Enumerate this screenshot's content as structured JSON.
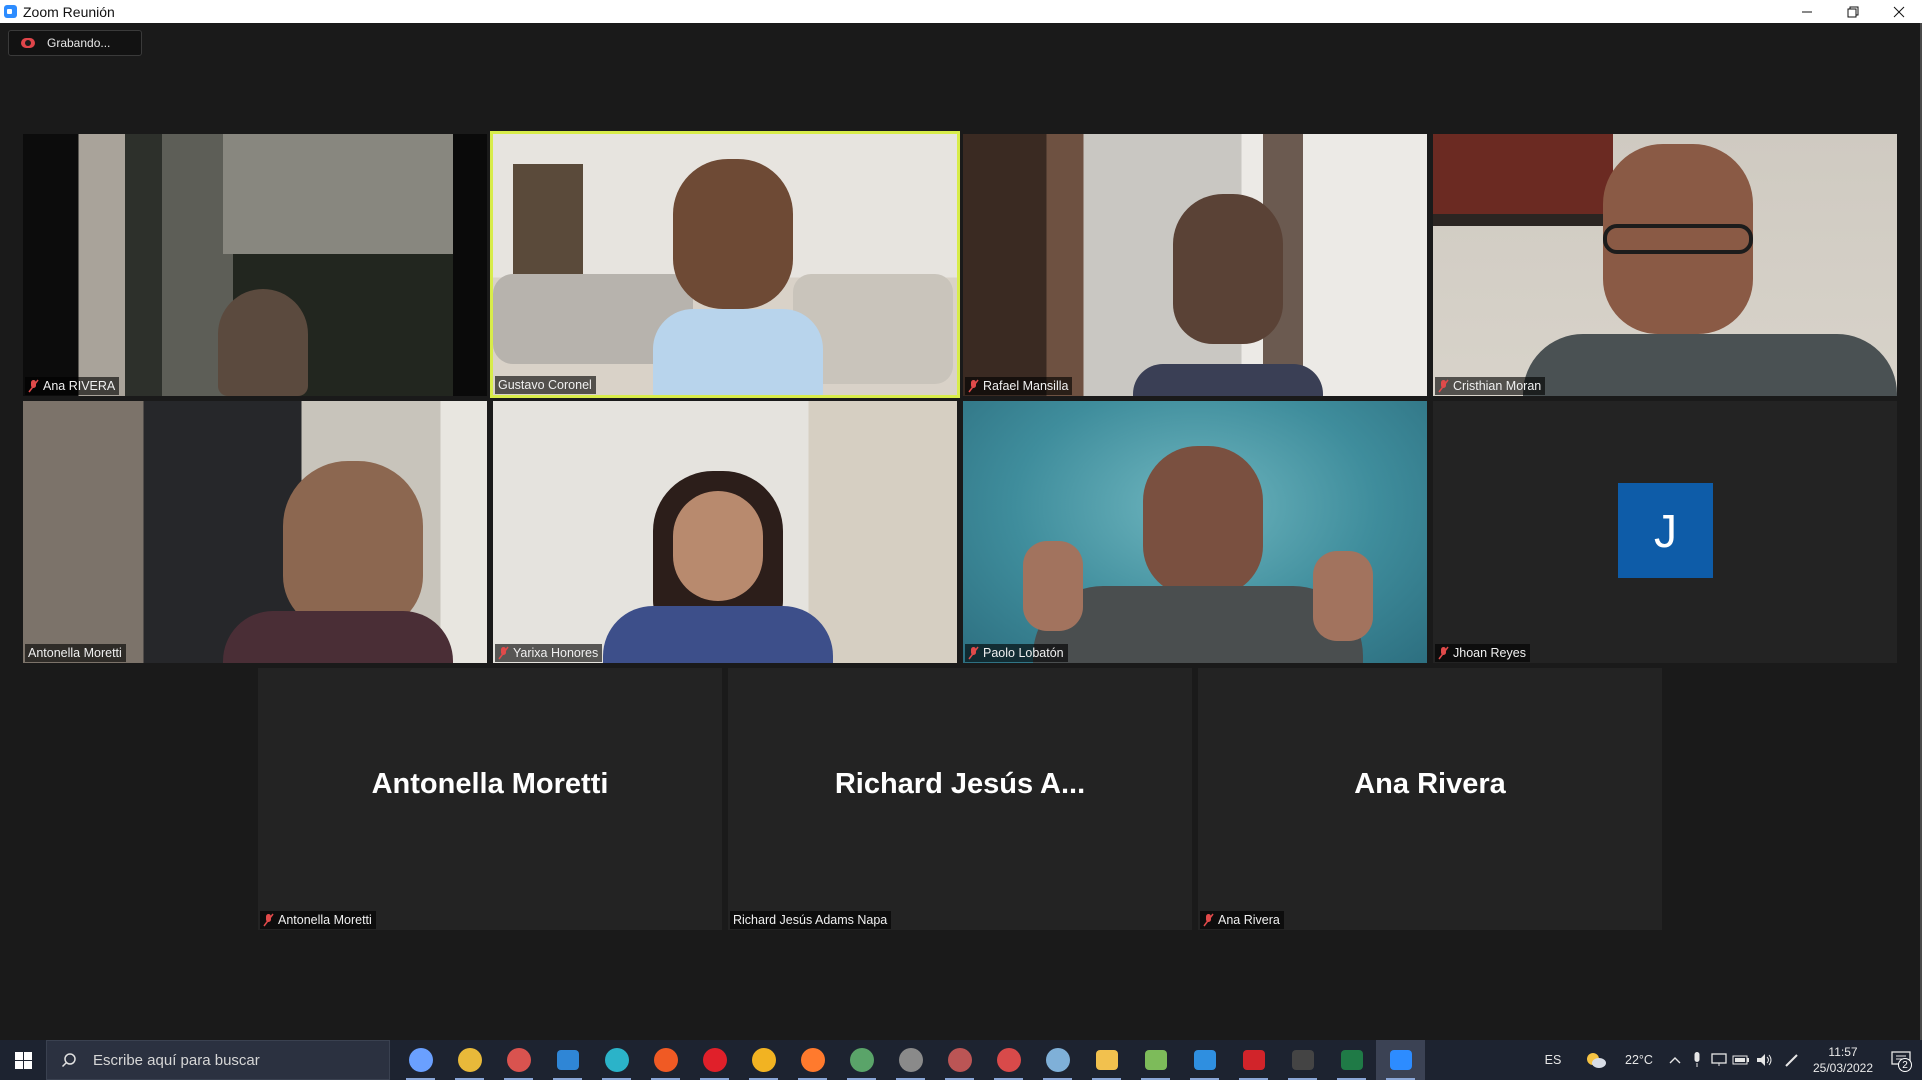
{
  "window": {
    "title": "Zoom Reunión",
    "icon": "zoom-icon",
    "controls": [
      "minimize-icon",
      "restore-icon",
      "close-icon"
    ]
  },
  "recording": {
    "label": "Grabando...",
    "icon": "cloud-record-icon",
    "color": "#e0454a"
  },
  "accent": {
    "active_speaker_border": "#d8ec4a",
    "avatar_bg": "#0e5ca8"
  },
  "participants": [
    {
      "name": "Ana RIVERA",
      "muted": true,
      "video": true
    },
    {
      "name": "Gustavo Coronel",
      "muted": false,
      "video": true,
      "active_speaker": true
    },
    {
      "name": "Rafael Mansilla",
      "muted": true,
      "video": true
    },
    {
      "name": "Cristhian Moran",
      "muted": true,
      "video": true
    },
    {
      "name": "Antonella Moretti",
      "muted": false,
      "video": true
    },
    {
      "name": "Yarixa Honores",
      "muted": true,
      "video": true
    },
    {
      "name": "Paolo Lobatón",
      "muted": true,
      "video": true
    },
    {
      "name": "Jhoan  Reyes",
      "muted": true,
      "video": false,
      "avatar_letter": "J"
    },
    {
      "name": "Antonella Moretti",
      "muted": true,
      "video": false,
      "display_name": "Antonella Moretti"
    },
    {
      "name": "Richard Jesús Adams Napa",
      "muted": false,
      "video": false,
      "display_name": "Richard  Jesús  A..."
    },
    {
      "name": "Ana Rivera",
      "muted": true,
      "video": false,
      "display_name": "Ana Rivera"
    }
  ],
  "taskbar": {
    "search_placeholder": "Escribe aquí para buscar",
    "apps": [
      {
        "icon": "chat-icon",
        "color": "#6aa0ff"
      },
      {
        "icon": "chrome-icon",
        "color": "#e8b93a"
      },
      {
        "icon": "chrome-icon",
        "color": "#d9534f"
      },
      {
        "icon": "mail-icon",
        "color": "#2f86d6"
      },
      {
        "icon": "edge-icon",
        "color": "#2bb3c9"
      },
      {
        "icon": "brave-icon",
        "color": "#f05a24"
      },
      {
        "icon": "opera-icon",
        "color": "#e0202a"
      },
      {
        "icon": "vpn-icon",
        "color": "#f2b322"
      },
      {
        "icon": "firefox-icon",
        "color": "#ff7a2d"
      },
      {
        "icon": "chrome-icon",
        "color": "#5aa469"
      },
      {
        "icon": "chrome-icon",
        "color": "#8a8a8a"
      },
      {
        "icon": "chrome-icon",
        "color": "#b55"
      },
      {
        "icon": "chrome-icon",
        "color": "#d84a4a"
      },
      {
        "icon": "paint-icon",
        "color": "#7fb0d8"
      },
      {
        "icon": "folder-icon",
        "color": "#f2c14e"
      },
      {
        "icon": "notepad-icon",
        "color": "#7dbb5a"
      },
      {
        "icon": "vscode-icon",
        "color": "#2f8fe0"
      },
      {
        "icon": "pdf-icon",
        "color": "#d1242a"
      },
      {
        "icon": "terminal-icon",
        "color": "#444"
      },
      {
        "icon": "excel-icon",
        "color": "#1f7a46"
      },
      {
        "icon": "zoom-icon",
        "color": "#2d8cff"
      }
    ],
    "language": "ES",
    "weather": "22°C",
    "time": "11:57",
    "date": "25/03/2022",
    "notifications": "2"
  }
}
